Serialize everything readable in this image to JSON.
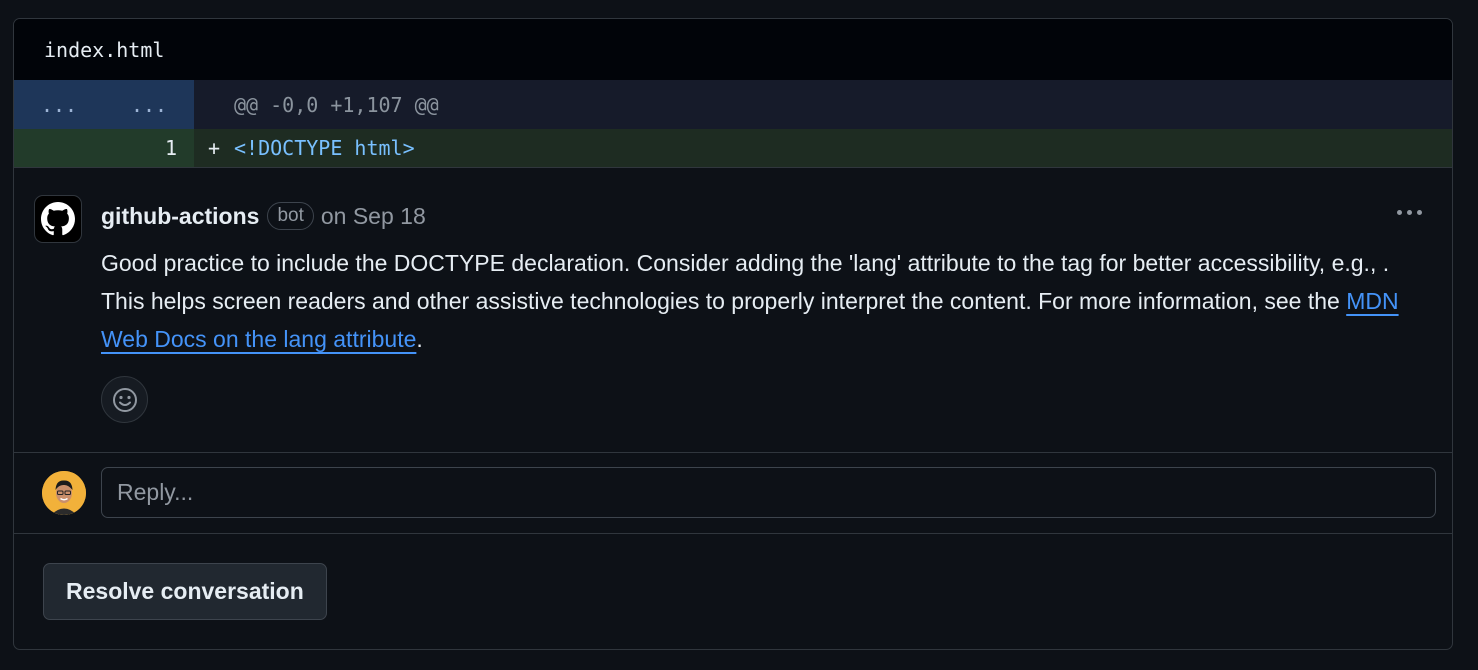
{
  "file": {
    "name": "index.html"
  },
  "diff": {
    "hunk": {
      "old_marker": "...",
      "new_marker": "...",
      "header": "@@ -0,0 +1,107 @@"
    },
    "lines": [
      {
        "new_line_number": "1",
        "sign": "+",
        "code": "<!DOCTYPE html>"
      }
    ]
  },
  "comment": {
    "author": "github-actions",
    "badge": "bot",
    "date": "on Sep 18",
    "body_part1": "Good practice to include the DOCTYPE declaration. Consider adding the 'lang' attribute to the tag for better accessibility, e.g., . This helps screen readers and other assistive technologies to properly interpret the content. For more information, see the ",
    "link_text": "MDN Web Docs on the lang attribute",
    "body_end": ".",
    "avatar_icon": "github-logo-icon",
    "menu_icon": "kebab-horizontal-icon",
    "reaction_icon": "smiley-icon"
  },
  "reply": {
    "placeholder": "Reply..."
  },
  "actions": {
    "resolve_label": "Resolve conversation"
  },
  "colors": {
    "background": "#0d1117",
    "link": "#4493f8",
    "hunk_gutter": "#1e3659",
    "addition_gutter": "#223b2a",
    "avatar_bg": "#f2b13a"
  }
}
